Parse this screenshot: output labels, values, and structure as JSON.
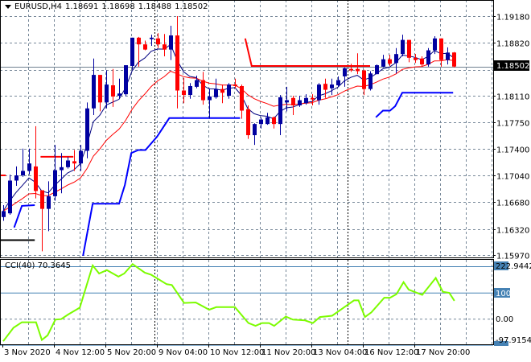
{
  "header": {
    "symbol": "EURUSD,H4",
    "open": "1.18691",
    "high": "1.18698",
    "low": "1.18488",
    "close": "1.18502"
  },
  "current_price_label": "1.18502",
  "cci_header": {
    "name": "CCI(40)",
    "value": "70.3645"
  },
  "colors": {
    "bull": "#0000a0",
    "bear": "#ff0000",
    "fast_ma": "#000080",
    "slow_ma": "#ff0000",
    "support": "#0000ff",
    "resistance": "#ff0000",
    "cci": "#7cfc00",
    "level": "#4682b4",
    "grid": "#778899"
  },
  "chart_data": [
    {
      "type": "candlestick",
      "title": "EURUSD,H4",
      "ylim": [
        1.1597,
        1.1918
      ],
      "y_ticks": [
        "1.19180",
        "1.18820",
        "1.18460",
        "1.18110",
        "1.17750",
        "1.17400",
        "1.17040",
        "1.16680",
        "1.16320",
        "1.15970"
      ],
      "y_tick_values": [
        1.1918,
        1.1882,
        1.1846,
        1.1811,
        1.1775,
        1.174,
        1.1704,
        1.1668,
        1.1632,
        1.1597
      ],
      "x_labels": [
        "3 Nov 2020",
        "4 Nov 12:00",
        "5 Nov 20:00",
        "9 Nov 04:00",
        "10 Nov 12:00",
        "11 Nov 20:00",
        "13 Nov 04:00",
        "16 Nov 12:00",
        "17 Nov 20:00"
      ],
      "x_label_bars": [
        0,
        8,
        16,
        24,
        32,
        40,
        48,
        56,
        64
      ],
      "day_separator_bars": [
        23,
        53
      ],
      "ohlc": [
        [
          1.1648,
          1.1664,
          1.1643,
          1.1656
        ],
        [
          1.1653,
          1.1705,
          1.1651,
          1.1697
        ],
        [
          1.1697,
          1.1716,
          1.169,
          1.1704
        ],
        [
          1.1704,
          1.174,
          1.1702,
          1.171
        ],
        [
          1.171,
          1.174,
          1.1705,
          1.172
        ],
        [
          1.1716,
          1.177,
          1.1673,
          1.1683
        ],
        [
          1.1684,
          1.1684,
          1.1602,
          1.1659
        ],
        [
          1.1659,
          1.1696,
          1.1629,
          1.1676
        ],
        [
          1.1676,
          1.1745,
          1.167,
          1.1711
        ],
        [
          1.1711,
          1.1734,
          1.168,
          1.1715
        ],
        [
          1.1715,
          1.1729,
          1.1713,
          1.1724
        ],
        [
          1.1723,
          1.1738,
          1.171,
          1.172
        ],
        [
          1.172,
          1.1745,
          1.171,
          1.1737
        ],
        [
          1.1737,
          1.1802,
          1.1727,
          1.1794
        ],
        [
          1.1794,
          1.1861,
          1.1785,
          1.1839
        ],
        [
          1.1839,
          1.1839,
          1.179,
          1.1802
        ],
        [
          1.1802,
          1.1845,
          1.1794,
          1.1826
        ],
        [
          1.1825,
          1.1847,
          1.1796,
          1.181
        ],
        [
          1.1811,
          1.1834,
          1.1807,
          1.1814
        ],
        [
          1.1813,
          1.1852,
          1.181,
          1.1852
        ],
        [
          1.1851,
          1.1889,
          1.1846,
          1.1889
        ],
        [
          1.1889,
          1.189,
          1.185,
          1.188
        ],
        [
          1.188,
          1.1885,
          1.1872,
          1.1873
        ],
        [
          1.1887,
          1.1893,
          1.1878,
          1.1889
        ],
        [
          1.1888,
          1.1895,
          1.1875,
          1.188
        ],
        [
          1.188,
          1.1894,
          1.1864,
          1.1873
        ],
        [
          1.1873,
          1.1905,
          1.1859,
          1.1892
        ],
        [
          1.1892,
          1.1918,
          1.1794,
          1.1818
        ],
        [
          1.1818,
          1.1835,
          1.1801,
          1.1812
        ],
        [
          1.1812,
          1.1828,
          1.1807,
          1.1824
        ],
        [
          1.1823,
          1.1838,
          1.1821,
          1.1832
        ],
        [
          1.1832,
          1.1843,
          1.1799,
          1.1805
        ],
        [
          1.1805,
          1.1821,
          1.178,
          1.181
        ],
        [
          1.1809,
          1.1834,
          1.1807,
          1.182
        ],
        [
          1.182,
          1.1826,
          1.1801,
          1.1815
        ],
        [
          1.1811,
          1.1828,
          1.1807,
          1.1826
        ],
        [
          1.1826,
          1.1834,
          1.1821,
          1.1824
        ],
        [
          1.1824,
          1.1826,
          1.178,
          1.1791
        ],
        [
          1.1793,
          1.1798,
          1.1753,
          1.1758
        ],
        [
          1.1758,
          1.1774,
          1.1745,
          1.1773
        ],
        [
          1.1773,
          1.1782,
          1.1767,
          1.1779
        ],
        [
          1.1773,
          1.1788,
          1.1772,
          1.1782
        ],
        [
          1.1782,
          1.1783,
          1.1767,
          1.1773
        ],
        [
          1.1773,
          1.1812,
          1.1758,
          1.1809
        ],
        [
          1.1802,
          1.1823,
          1.179,
          1.1805
        ],
        [
          1.1808,
          1.1811,
          1.1785,
          1.1798
        ],
        [
          1.1798,
          1.1811,
          1.1796,
          1.1805
        ],
        [
          1.1801,
          1.1813,
          1.1799,
          1.1808
        ],
        [
          1.1808,
          1.1813,
          1.1798,
          1.1806
        ],
        [
          1.1805,
          1.1828,
          1.1799,
          1.1826
        ],
        [
          1.1827,
          1.1834,
          1.1808,
          1.1819
        ],
        [
          1.1821,
          1.1834,
          1.1812,
          1.1826
        ],
        [
          1.1825,
          1.1837,
          1.1823,
          1.1832
        ],
        [
          1.1837,
          1.1849,
          1.1823,
          1.1848
        ],
        [
          1.1847,
          1.1854,
          1.1843,
          1.1845
        ],
        [
          1.1847,
          1.1868,
          1.184,
          1.1844
        ],
        [
          1.1845,
          1.1846,
          1.1812,
          1.182
        ],
        [
          1.182,
          1.1844,
          1.1818,
          1.1841
        ],
        [
          1.184,
          1.1853,
          1.184,
          1.1852
        ],
        [
          1.185,
          1.1866,
          1.1849,
          1.186
        ],
        [
          1.186,
          1.1866,
          1.1851,
          1.1854
        ],
        [
          1.1855,
          1.1875,
          1.1841,
          1.1867
        ],
        [
          1.1867,
          1.1893,
          1.1864,
          1.1886
        ],
        [
          1.1886,
          1.1886,
          1.1856,
          1.1862
        ],
        [
          1.1862,
          1.1867,
          1.1855,
          1.1859
        ],
        [
          1.1861,
          1.1864,
          1.185,
          1.1853
        ],
        [
          1.1853,
          1.1875,
          1.185,
          1.1872
        ],
        [
          1.1872,
          1.1891,
          1.1867,
          1.1888
        ],
        [
          1.1888,
          1.1888,
          1.185,
          1.1859
        ],
        [
          1.1859,
          1.1876,
          1.1853,
          1.1869
        ],
        [
          1.18691,
          1.18698,
          1.18488,
          1.18502
        ]
      ],
      "current_price": 1.18502,
      "support_line": [
        [
          1.7,
          1.1634
        ],
        [
          2.9,
          1.1663
        ],
        [
          4.9,
          1.1664
        ]
      ],
      "support_line_2": [
        [
          12.4,
          1.1596
        ],
        [
          13.9,
          1.1666
        ],
        [
          18,
          1.1666
        ],
        [
          18.9,
          1.1691
        ],
        [
          19.9,
          1.1734
        ],
        [
          21,
          1.1738
        ],
        [
          22.1,
          1.1738
        ],
        [
          23.9,
          1.1756
        ],
        [
          25.8,
          1.1781
        ],
        [
          36.8,
          1.1781
        ]
      ],
      "support_line_3": [
        [
          57.9,
          1.1782
        ],
        [
          59,
          1.1791
        ],
        [
          60.1,
          1.1791
        ],
        [
          60.9,
          1.1797
        ],
        [
          62,
          1.1815
        ],
        [
          69.9,
          1.1815
        ]
      ],
      "resistance_line": [
        [
          -0.5,
          1.1704
        ],
        [
          0.4,
          1.1704
        ]
      ],
      "resistance_line_2": [
        [
          5.8,
          1.1729
        ],
        [
          10.9,
          1.1729
        ]
      ],
      "resistance_line_3": [
        [
          37.6,
          1.1888
        ],
        [
          38.6,
          1.1851
        ],
        [
          57,
          1.1851
        ]
      ],
      "black_line": [
        [
          -0.4,
          1.1617
        ],
        [
          4.9,
          1.1617
        ]
      ]
    },
    {
      "type": "line",
      "title": "CCI(40) 70.3645",
      "ylim": [
        -97.9154,
        222.9442
      ],
      "y_ticks": [
        "222.9442",
        "100",
        "0.00",
        "-97.9154"
      ],
      "levels": [
        100,
        -100
      ],
      "points": [
        [
          0,
          -85
        ],
        [
          1.6,
          -33
        ],
        [
          2.9,
          -12
        ],
        [
          5.1,
          -12
        ],
        [
          6,
          -80
        ],
        [
          6.9,
          -62
        ],
        [
          8.1,
          -2
        ],
        [
          9,
          0
        ],
        [
          10.1,
          18
        ],
        [
          11.9,
          44
        ],
        [
          13.9,
          206
        ],
        [
          14.9,
          175
        ],
        [
          16.1,
          188
        ],
        [
          17.9,
          163
        ],
        [
          18.8,
          175
        ],
        [
          20.1,
          211
        ],
        [
          22,
          178
        ],
        [
          23,
          170
        ],
        [
          25.4,
          134
        ],
        [
          26.2,
          131
        ],
        [
          28.1,
          62
        ],
        [
          29.9,
          64
        ],
        [
          32,
          36
        ],
        [
          33.1,
          46
        ],
        [
          36,
          46
        ],
        [
          38.1,
          -15
        ],
        [
          39.2,
          -26
        ],
        [
          40.2,
          -15
        ],
        [
          41.3,
          -15
        ],
        [
          42.1,
          -26
        ],
        [
          43.9,
          10
        ],
        [
          45,
          -2
        ],
        [
          46.9,
          -5
        ],
        [
          48.1,
          -15
        ],
        [
          49.2,
          8
        ],
        [
          51.1,
          13
        ],
        [
          54.5,
          72
        ],
        [
          55.2,
          72
        ],
        [
          56.2,
          8
        ],
        [
          57.2,
          26
        ],
        [
          59.2,
          82
        ],
        [
          60.1,
          82
        ],
        [
          61.1,
          96
        ],
        [
          62.2,
          142
        ],
        [
          63,
          113
        ],
        [
          65.1,
          93
        ],
        [
          67.2,
          158
        ],
        [
          68.3,
          105
        ],
        [
          69.3,
          101
        ],
        [
          70.1,
          70.36
        ]
      ]
    }
  ]
}
